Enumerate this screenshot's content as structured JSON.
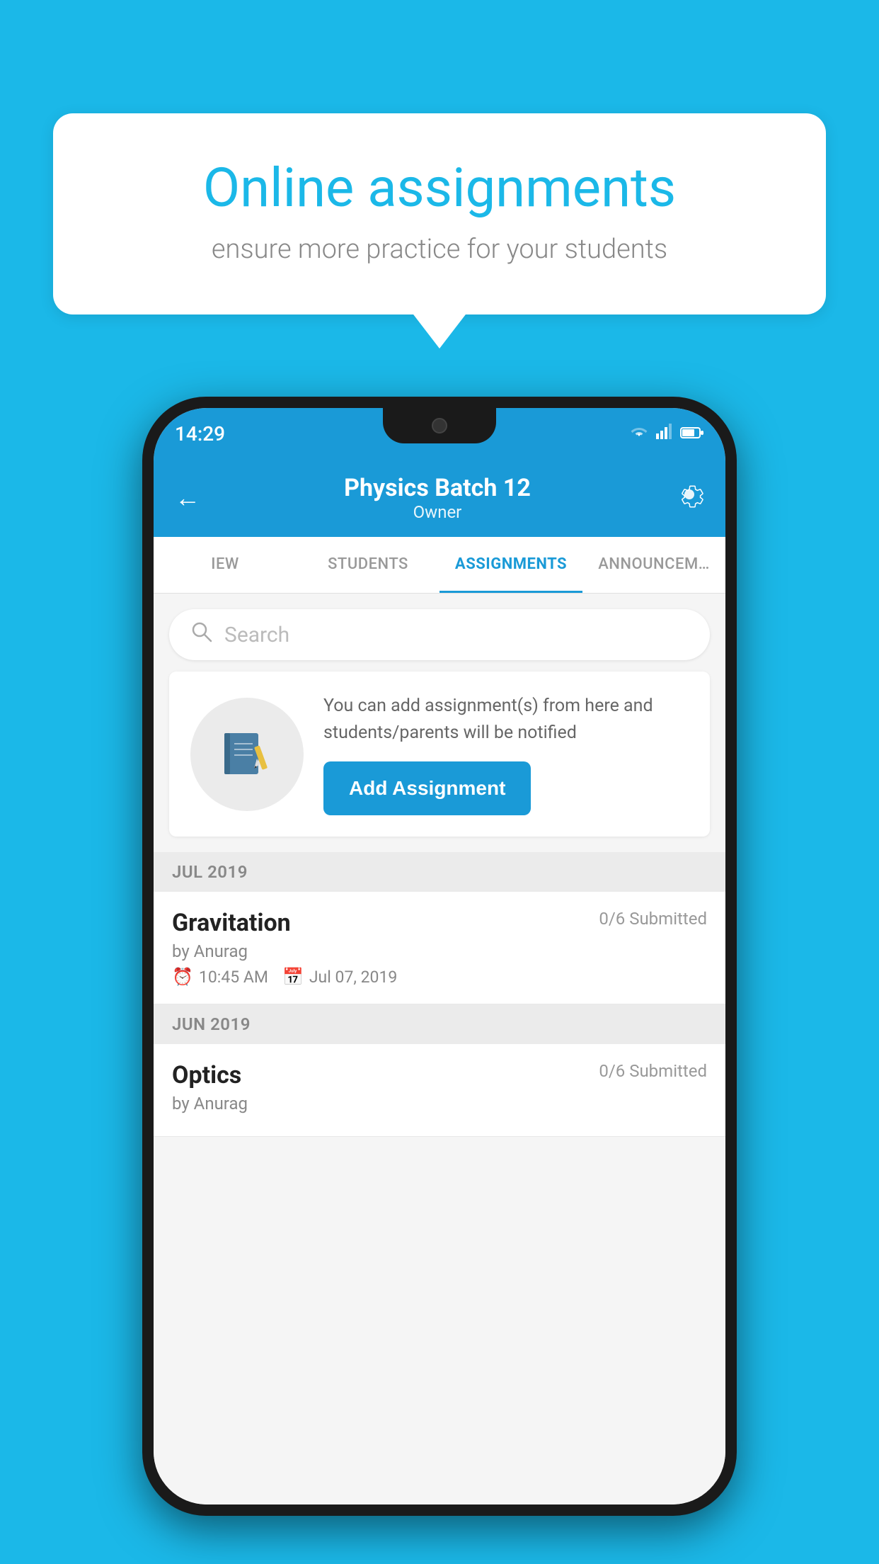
{
  "background_color": "#1BB8E8",
  "speech_bubble": {
    "title": "Online assignments",
    "subtitle": "ensure more practice for your students"
  },
  "status_bar": {
    "time": "14:29",
    "icons": [
      "wifi",
      "signal",
      "battery"
    ]
  },
  "header": {
    "title": "Physics Batch 12",
    "subtitle": "Owner",
    "back_label": "←",
    "settings_label": "⚙"
  },
  "tabs": [
    {
      "label": "IEW",
      "active": false
    },
    {
      "label": "STUDENTS",
      "active": false
    },
    {
      "label": "ASSIGNMENTS",
      "active": true
    },
    {
      "label": "ANNOUNCEM…",
      "active": false
    }
  ],
  "search": {
    "placeholder": "Search"
  },
  "empty_state": {
    "description": "You can add assignment(s) from here and students/parents will be notified",
    "button_label": "Add Assignment"
  },
  "sections": [
    {
      "label": "JUL 2019",
      "assignments": [
        {
          "title": "Gravitation",
          "submitted": "0/6 Submitted",
          "by": "by Anurag",
          "time": "10:45 AM",
          "date": "Jul 07, 2019"
        }
      ]
    },
    {
      "label": "JUN 2019",
      "assignments": [
        {
          "title": "Optics",
          "submitted": "0/6 Submitted",
          "by": "by Anurag",
          "time": "",
          "date": ""
        }
      ]
    }
  ]
}
